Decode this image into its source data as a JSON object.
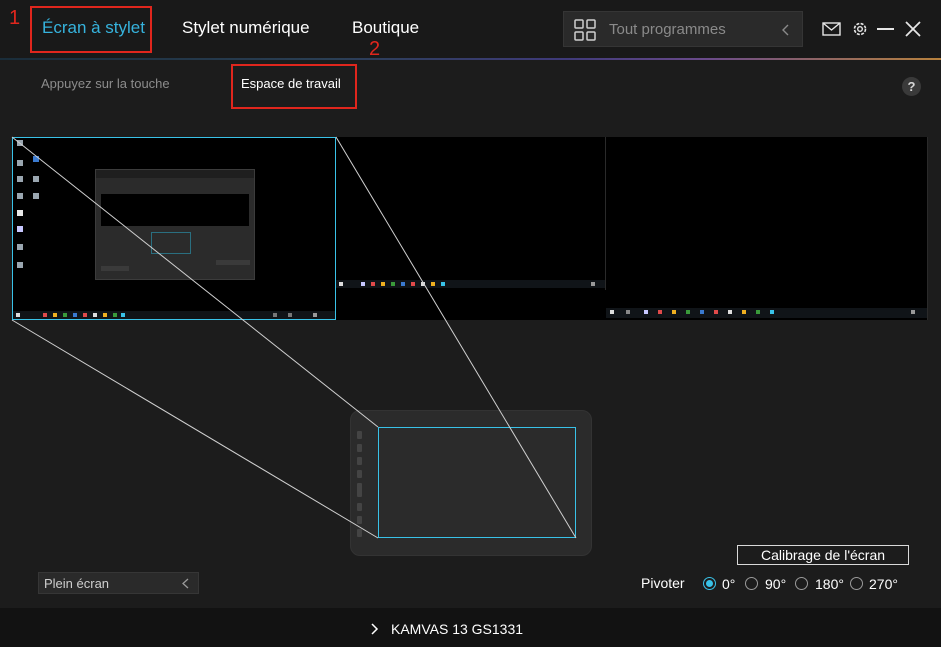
{
  "markers": {
    "first": "1",
    "second": "2"
  },
  "nav": {
    "tabs": [
      {
        "label": "Écran à stylet"
      },
      {
        "label": "Stylet numérique"
      },
      {
        "label": "Boutique"
      }
    ]
  },
  "header": {
    "program_selector": "Tout programmes",
    "icons": [
      "grid-icon",
      "chevron-left-icon",
      "mail-icon",
      "gear-icon",
      "minimize-icon",
      "close-icon"
    ]
  },
  "subtabs": [
    {
      "label": "Appuyez sur la touche"
    },
    {
      "label": "Espace de travail"
    }
  ],
  "help": "?",
  "workspace": {
    "calibrate_label": "Calibrage de l'écran",
    "mapping_select": "Plein écran",
    "rotate_label": "Pivoter",
    "rotation_options": [
      {
        "label": "0°",
        "checked": true
      },
      {
        "label": "90°",
        "checked": false
      },
      {
        "label": "180°",
        "checked": false
      },
      {
        "label": "270°",
        "checked": false
      }
    ]
  },
  "device": {
    "name": "KAMVAS 13 GS1331"
  },
  "colors": {
    "accent": "#39c2e8",
    "active_tab": "#36b3dd",
    "annotation": "#e0261d"
  }
}
